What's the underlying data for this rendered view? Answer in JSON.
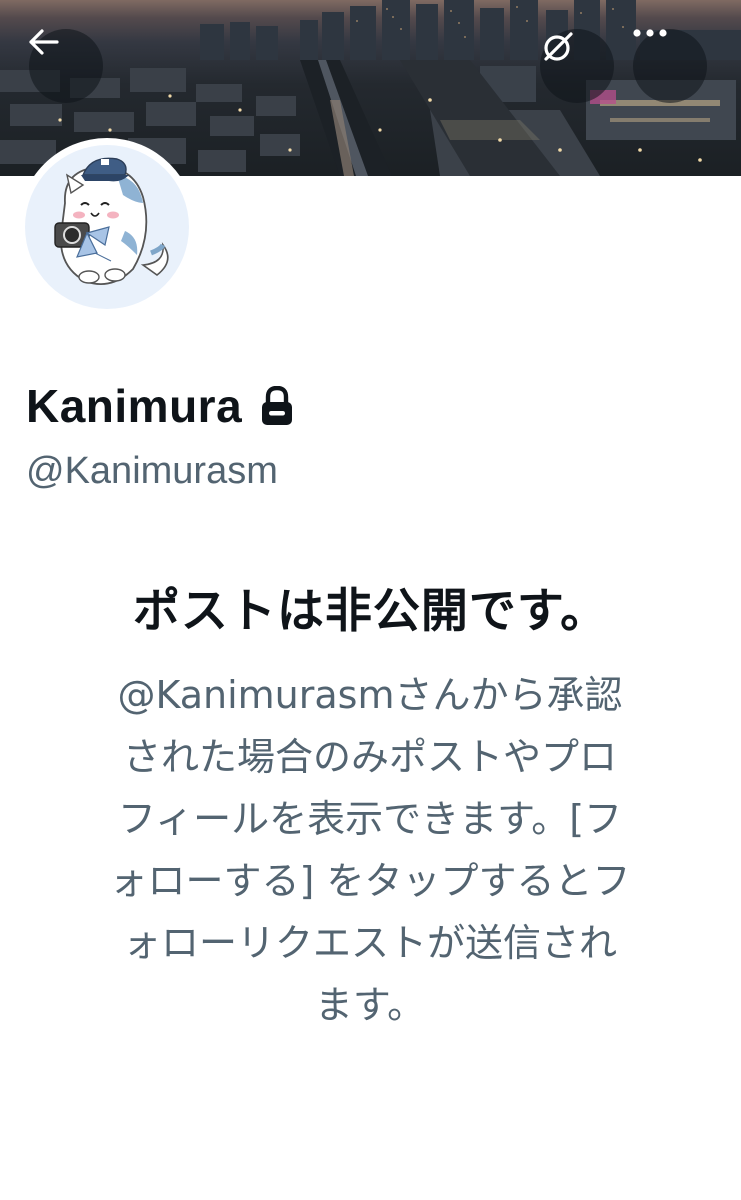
{
  "header": {
    "back_icon": "arrow-left-icon",
    "translate_icon": "grok-circle-slash-icon",
    "more_icon": "more-horizontal-icon"
  },
  "profile": {
    "display_name": "Kanimura",
    "handle": "@Kanimurasm",
    "protected_icon": "lock-icon"
  },
  "private_notice": {
    "title": "ポストは非公開です。",
    "body_lines": [
      "@Kanimurasmさんから承認",
      "された場合のみポストやプロ",
      "フィールを表示できます。[フ",
      "ォローする] をタップするとフ",
      "ォローリクエストが送信され",
      "ます。"
    ]
  }
}
